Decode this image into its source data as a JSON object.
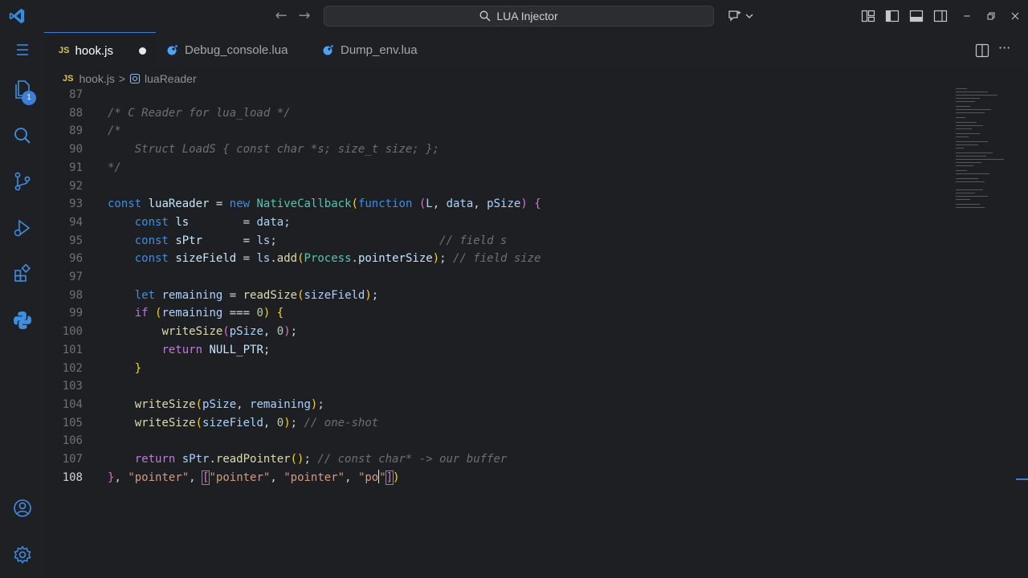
{
  "titlebar": {
    "search_label": "LUA Injector"
  },
  "activity": {
    "explorer_badge": "1"
  },
  "tabs": [
    {
      "icon": "JS",
      "label": "hook.js"
    },
    {
      "label": "Debug_console.lua"
    },
    {
      "label": "Dump_env.lua"
    }
  ],
  "breadcrumb": {
    "file_icon": "JS",
    "file": "hook.js",
    "separator": ">",
    "symbol": "luaReader"
  },
  "editor": {
    "line_numbers": [
      "87",
      "88",
      "89",
      "90",
      "91",
      "92",
      "93",
      "94",
      "95",
      "96",
      "97",
      "98",
      "99",
      "100",
      "101",
      "102",
      "103",
      "104",
      "105",
      "106",
      "107",
      "108"
    ],
    "current_line": "108"
  },
  "colors": {
    "accent": "#3d7ddb",
    "background": "#1e1f22"
  }
}
